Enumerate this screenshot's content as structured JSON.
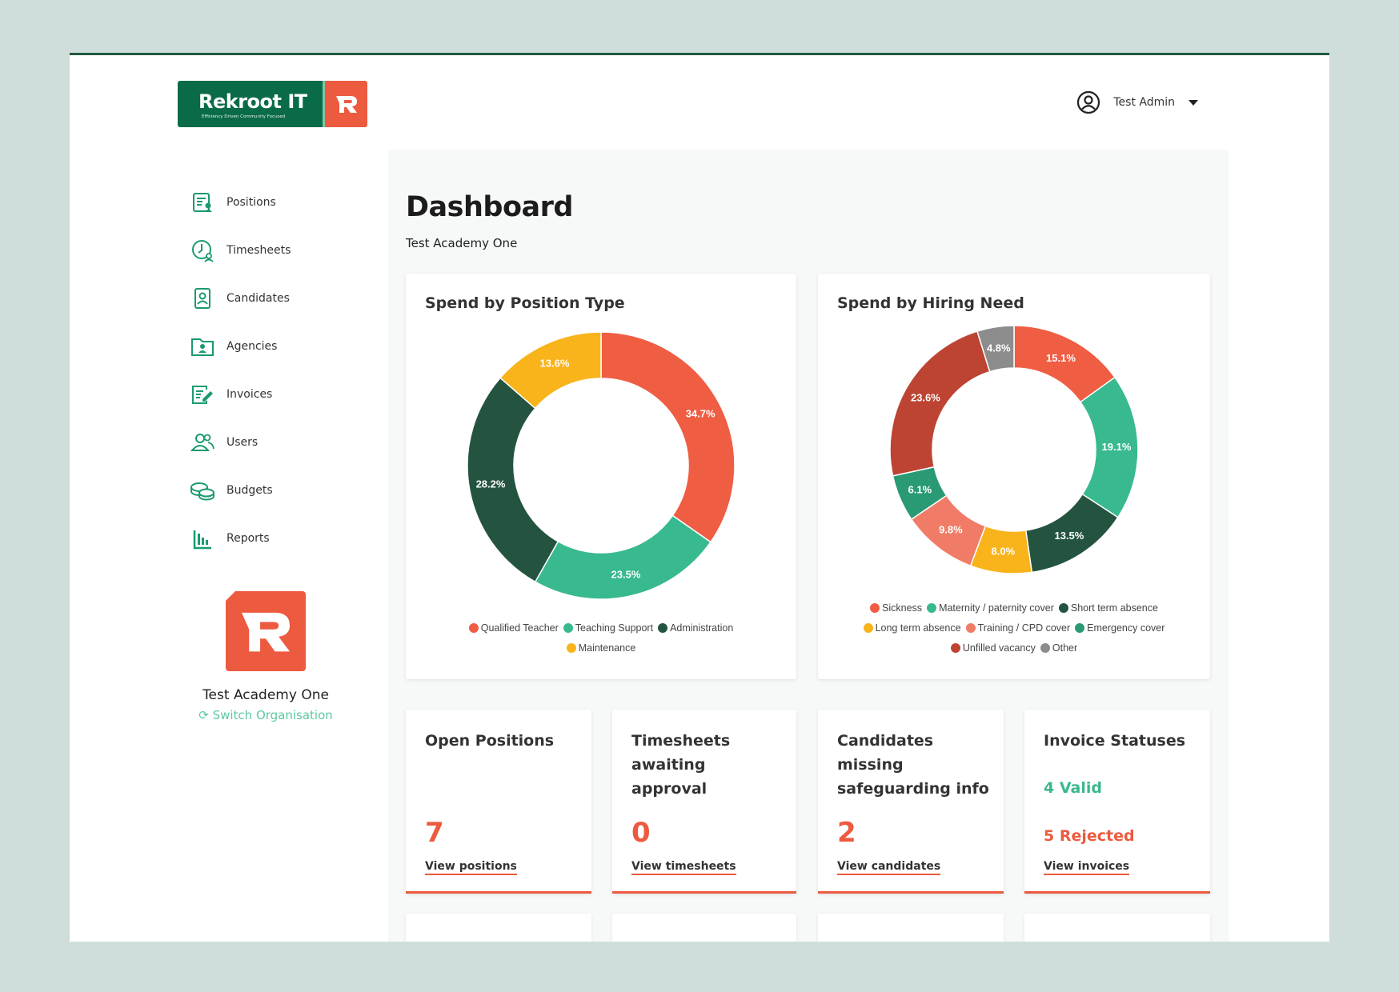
{
  "header": {
    "logo_text": "Rekroot IT",
    "logo_tagline": "Efficiency Driven Community Focused",
    "user_name": "Test Admin"
  },
  "sidebar": {
    "items": [
      {
        "label": "Positions",
        "icon": "positions-icon"
      },
      {
        "label": "Timesheets",
        "icon": "timesheets-icon"
      },
      {
        "label": "Candidates",
        "icon": "candidates-icon"
      },
      {
        "label": "Agencies",
        "icon": "agencies-icon"
      },
      {
        "label": "Invoices",
        "icon": "invoices-icon"
      },
      {
        "label": "Users",
        "icon": "users-icon"
      },
      {
        "label": "Budgets",
        "icon": "budgets-icon"
      },
      {
        "label": "Reports",
        "icon": "reports-icon"
      }
    ],
    "org_name": "Test Academy One",
    "switch_label": "Switch Organisation"
  },
  "main": {
    "title": "Dashboard",
    "subtitle": "Test Academy One"
  },
  "chart_data": [
    {
      "type": "pie",
      "title": "Spend by Position Type",
      "donut": true,
      "categories": [
        "Qualified Teacher",
        "Teaching Support",
        "Administration",
        "Maintenance"
      ],
      "values": [
        34.7,
        23.5,
        28.2,
        13.6
      ],
      "colors": [
        "#ef5d43",
        "#38b98f",
        "#245440",
        "#f9b31b"
      ],
      "legend": "bottom"
    },
    {
      "type": "pie",
      "title": "Spend by Hiring Need",
      "donut": true,
      "categories": [
        "Sickness",
        "Maternity / paternity cover",
        "Short term absence",
        "Long term absence",
        "Training / CPD cover",
        "Emergency cover",
        "Unfilled vacancy",
        "Other"
      ],
      "values": [
        15.1,
        19.1,
        13.5,
        8.0,
        9.8,
        6.1,
        23.6,
        4.8
      ],
      "colors": [
        "#ef5d43",
        "#38b98f",
        "#245440",
        "#f9b31b",
        "#f07c68",
        "#2a9a74",
        "#bd4433",
        "#8c8c8c"
      ],
      "legend": "bottom"
    }
  ],
  "stats": [
    {
      "title": "Open Positions",
      "value": "7",
      "link": "View positions"
    },
    {
      "title": "Timesheets awaiting approval",
      "value": "0",
      "link": "View timesheets"
    },
    {
      "title": "Candidates missing safeguarding info",
      "value": "2",
      "link": "View candidates"
    },
    {
      "title": "Invoice Statuses",
      "valid": "4 Valid",
      "rejected": "5 Rejected",
      "link": "View invoices"
    }
  ]
}
